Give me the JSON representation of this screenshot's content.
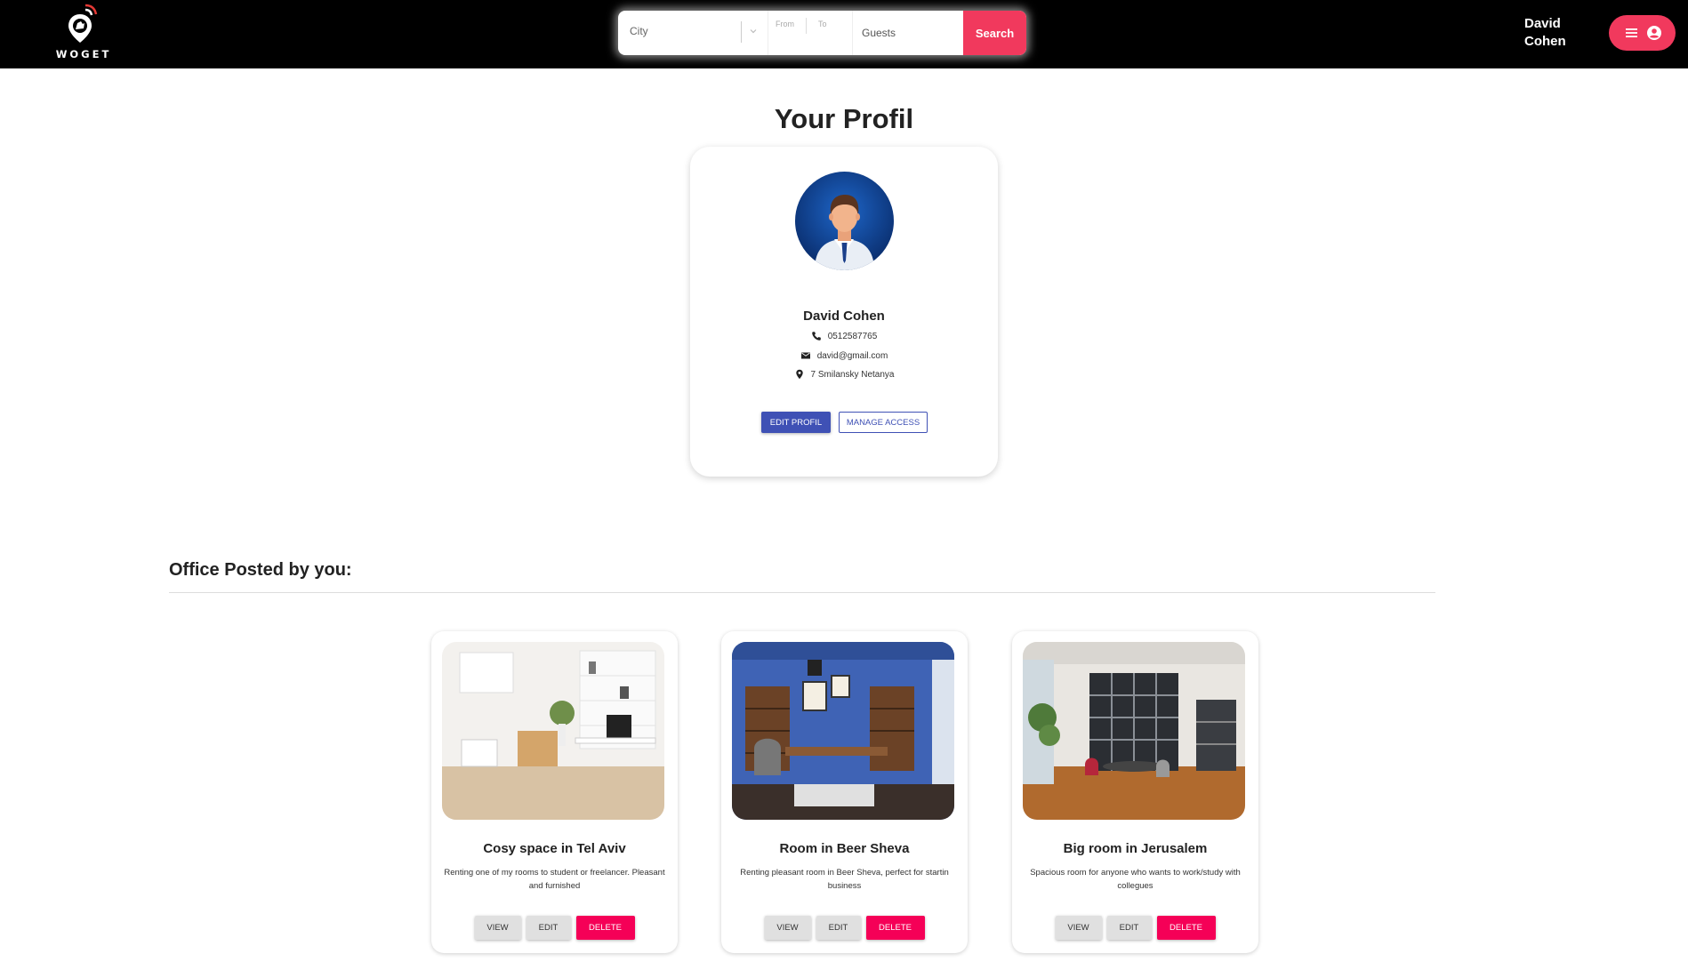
{
  "header": {
    "logo_text": "WOGET",
    "search": {
      "city_placeholder": "City",
      "from_label": "From",
      "to_label": "To",
      "guests_placeholder": "Guests",
      "button_label": "Search"
    },
    "user": {
      "first_name": "David",
      "last_name": "Cohen"
    },
    "icons": {
      "menu": "hamburger-icon",
      "account": "account-circle-icon"
    }
  },
  "profile": {
    "heading": "Your Profil",
    "name": "David Cohen",
    "phone": "0512587765",
    "email": "david@gmail.com",
    "address": "7 Smilansky Netanya",
    "edit_button": "EDIT PROFIL",
    "manage_button": "MANAGE ACCESS",
    "icons": {
      "phone": "phone-icon",
      "email": "mail-icon",
      "address": "location-pin-icon"
    }
  },
  "offices": {
    "heading": "Office Posted by you:",
    "items": [
      {
        "title": "Cosy space in Tel Aviv",
        "description": "Renting one of my rooms to student or freelancer. Pleasant and furnished",
        "view": "VIEW",
        "edit": "EDIT",
        "delete": "DELETE"
      },
      {
        "title": "Room in Beer Sheva",
        "description": "Renting pleasant room in Beer Sheva, perfect for startin business",
        "view": "VIEW",
        "edit": "EDIT",
        "delete": "DELETE"
      },
      {
        "title": "Big room in Jerusalem",
        "description": "Spacious room for anyone who wants to work/study with collegues",
        "view": "VIEW",
        "edit": "EDIT",
        "delete": "DELETE"
      }
    ]
  },
  "colors": {
    "header_bg": "#000000",
    "accent_pink": "#f1395d",
    "primary_blue": "#3f51b5",
    "delete_red": "#f50057",
    "neutral_button": "#e0e0e0"
  }
}
